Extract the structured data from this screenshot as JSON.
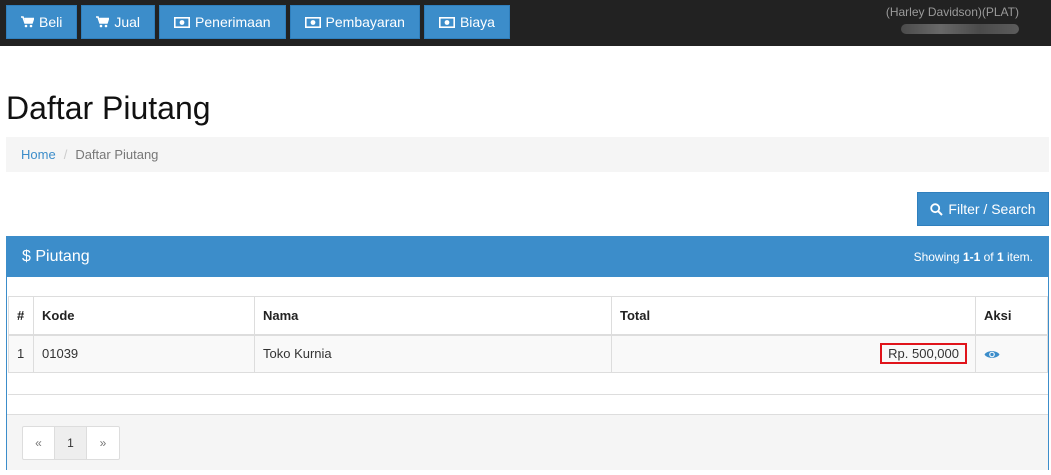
{
  "nav": {
    "items": [
      {
        "label": "Beli",
        "icon": "cart-icon"
      },
      {
        "label": "Jual",
        "icon": "cart-icon"
      },
      {
        "label": "Penerimaan",
        "icon": "money-icon"
      },
      {
        "label": "Pembayaran",
        "icon": "money-icon"
      },
      {
        "label": "Biaya",
        "icon": "money-icon"
      }
    ]
  },
  "user": {
    "name": "(Harley Davidson)(PLAT)"
  },
  "page": {
    "title": "Daftar Piutang"
  },
  "breadcrumb": {
    "home": "Home",
    "current": "Daftar Piutang"
  },
  "filter": {
    "label": "Filter / Search"
  },
  "panel": {
    "title": "$ Piutang",
    "summary_prefix": "Showing ",
    "summary_range": "1-1",
    "summary_mid": " of ",
    "summary_total": "1",
    "summary_suffix": " item."
  },
  "table": {
    "headers": [
      "#",
      "Kode",
      "Nama",
      "Total",
      "Aksi"
    ],
    "rows": [
      {
        "no": "1",
        "kode": "01039",
        "nama": "Toko Kurnia",
        "total": "Rp. 500,000",
        "action_icon": "eye-icon"
      }
    ]
  },
  "pagination": {
    "prev": "«",
    "page": "1",
    "next": "»"
  },
  "colors": {
    "primary": "#3c8dca",
    "topbar": "#222222",
    "highlight": "#e0141b"
  }
}
